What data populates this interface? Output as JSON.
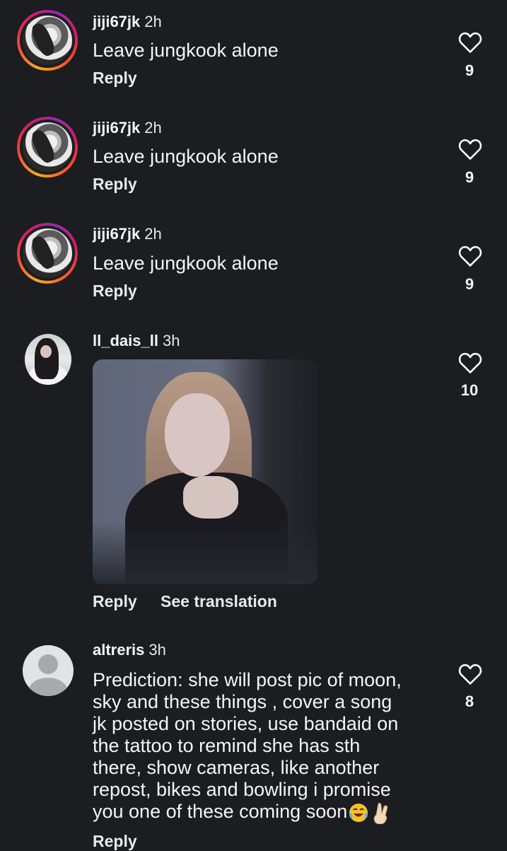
{
  "comments": [
    {
      "user": "jiji67jk",
      "time": "2h",
      "text": "Leave jungkook alone",
      "reply": "Reply",
      "likes": "9"
    },
    {
      "user": "jiji67jk",
      "time": "2h",
      "text": "Leave jungkook alone",
      "reply": "Reply",
      "likes": "9"
    },
    {
      "user": "jiji67jk",
      "time": "2h",
      "text": "Leave jungkook alone",
      "reply": "Reply",
      "likes": "9"
    },
    {
      "user": "ll_dais_ll",
      "time": "3h",
      "reply": "Reply",
      "translate": "See translation",
      "likes": "10"
    },
    {
      "user": "altreris",
      "time": "3h",
      "lines": [
        "Prediction: she will post pic of moon,",
        "sky and these things , cover a song",
        "jk posted on stories, use bandaid on",
        "the tattoo to remind she has sth",
        "there, show cameras, like another",
        "repost, bikes and bowling i promise",
        "you one of these coming soon"
      ],
      "reply": "Reply",
      "likes": "8"
    }
  ],
  "colors": {
    "background": "#1b1d20",
    "text": "#f5f5f5",
    "heart_outline": "#ffffff"
  }
}
